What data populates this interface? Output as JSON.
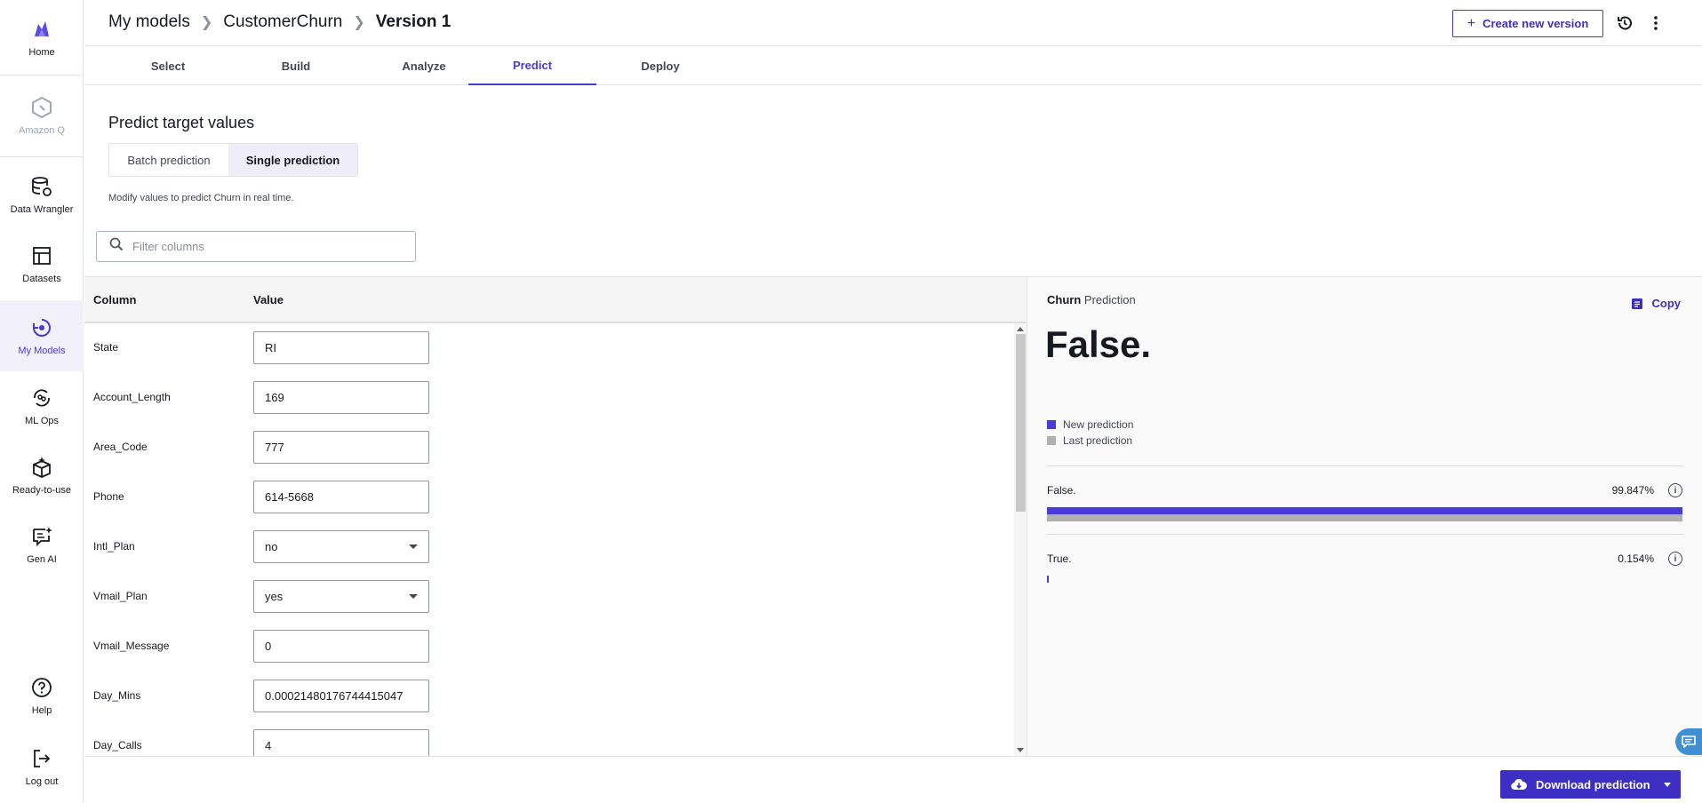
{
  "sidebar": {
    "items": [
      {
        "label": "Home",
        "icon": "canvas-logo-icon"
      },
      {
        "label": "Amazon Q",
        "icon": "amazon-q-icon"
      },
      {
        "label": "Data Wrangler",
        "icon": "data-wrangler-icon"
      },
      {
        "label": "Datasets",
        "icon": "datasets-icon"
      },
      {
        "label": "My Models",
        "icon": "my-models-icon"
      },
      {
        "label": "ML Ops",
        "icon": "ml-ops-icon"
      },
      {
        "label": "Ready-to-use",
        "icon": "ready-to-use-icon"
      },
      {
        "label": "Gen AI",
        "icon": "gen-ai-icon"
      },
      {
        "label": "Help",
        "icon": "help-icon"
      },
      {
        "label": "Log out",
        "icon": "logout-icon"
      }
    ]
  },
  "header": {
    "breadcrumb": [
      "My models",
      "CustomerChurn",
      "Version 1"
    ],
    "create_version_label": "Create new version"
  },
  "tabs": [
    "Select",
    "Build",
    "Analyze",
    "Predict",
    "Deploy"
  ],
  "active_tab": "Predict",
  "main": {
    "title": "Predict target values",
    "modes": [
      "Batch prediction",
      "Single prediction"
    ],
    "active_mode": "Single prediction",
    "hint": "Modify values to predict Churn in real time.",
    "filter_placeholder": "Filter columns"
  },
  "table": {
    "headers": [
      "Column",
      "Value"
    ],
    "rows": [
      {
        "column": "State",
        "value": "RI",
        "type": "text"
      },
      {
        "column": "Account_Length",
        "value": "169",
        "type": "text"
      },
      {
        "column": "Area_Code",
        "value": "777",
        "type": "text"
      },
      {
        "column": "Phone",
        "value": "614-5668",
        "type": "text"
      },
      {
        "column": "Intl_Plan",
        "value": "no",
        "type": "select"
      },
      {
        "column": "Vmail_Plan",
        "value": "yes",
        "type": "select"
      },
      {
        "column": "Vmail_Message",
        "value": "0",
        "type": "text"
      },
      {
        "column": "Day_Mins",
        "value": "0.00021480176744415047",
        "type": "text"
      },
      {
        "column": "Day_Calls",
        "value": "4",
        "type": "text"
      }
    ]
  },
  "prediction": {
    "target": "Churn",
    "target_suffix": "Prediction",
    "copy_label": "Copy",
    "result": "False.",
    "legend": [
      {
        "label": "New prediction",
        "color": "#4a3ad8"
      },
      {
        "label": "Last prediction",
        "color": "#b0b0b0"
      }
    ],
    "outcomes": [
      {
        "label": "False.",
        "percent_text": "99.847%",
        "new_fraction": 0.99847,
        "last_fraction": 0.99847
      },
      {
        "label": "True.",
        "percent_text": "0.154%",
        "new_fraction": 0.00154,
        "last_fraction": 0.00154
      }
    ]
  },
  "footer": {
    "download_label": "Download prediction"
  },
  "colors": {
    "accent": "#4a3ad8",
    "accent_dark": "#3d2ec4",
    "last_prediction": "#b0b0b0",
    "chat_bubble": "#3d8fd6"
  }
}
